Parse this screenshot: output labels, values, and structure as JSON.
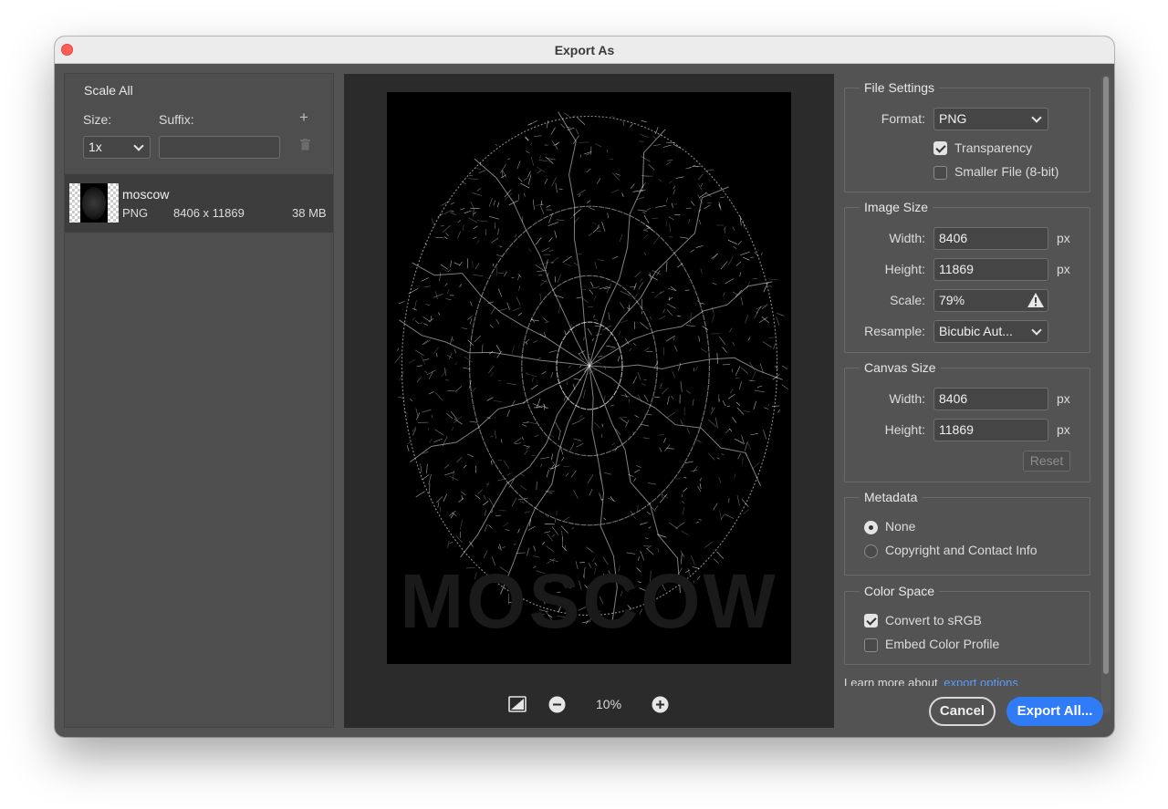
{
  "window": {
    "title": "Export As"
  },
  "scale_all": {
    "title": "Scale All",
    "size_label": "Size:",
    "suffix_label": "Suffix:",
    "size_value": "1x",
    "suffix_value": "",
    "add_symbol": "+"
  },
  "asset": {
    "name": "moscow",
    "format": "PNG",
    "dimensions": "8406 x 11869",
    "file_size": "38 MB"
  },
  "preview": {
    "zoom": "10%",
    "watermark_text": "MOSCOW"
  },
  "file_settings": {
    "title": "File Settings",
    "format_label": "Format:",
    "format_value": "PNG",
    "transparency_label": "Transparency",
    "transparency_checked": true,
    "smaller_file_label": "Smaller File (8-bit)",
    "smaller_file_checked": false
  },
  "image_size": {
    "title": "Image Size",
    "width_label": "Width:",
    "width_value": "8406",
    "height_label": "Height:",
    "height_value": "11869",
    "scale_label": "Scale:",
    "scale_value": "79%",
    "resample_label": "Resample:",
    "resample_value": "Bicubic Aut...",
    "unit": "px"
  },
  "canvas_size": {
    "title": "Canvas Size",
    "width_label": "Width:",
    "width_value": "8406",
    "height_label": "Height:",
    "height_value": "11869",
    "unit": "px",
    "reset_label": "Reset"
  },
  "metadata": {
    "title": "Metadata",
    "options": [
      "None",
      "Copyright and Contact Info"
    ],
    "selected": "None"
  },
  "color_space": {
    "title": "Color Space",
    "convert_label": "Convert to sRGB",
    "convert_checked": true,
    "embed_label": "Embed Color Profile",
    "embed_checked": false
  },
  "footer": {
    "learn_more_text": "Learn more about",
    "learn_more_link": "export options",
    "cancel_label": "Cancel",
    "export_label": "Export All..."
  },
  "colors": {
    "accent": "#2f7cf6",
    "link": "#5b9cf5",
    "close_button": "#ff5f57"
  }
}
